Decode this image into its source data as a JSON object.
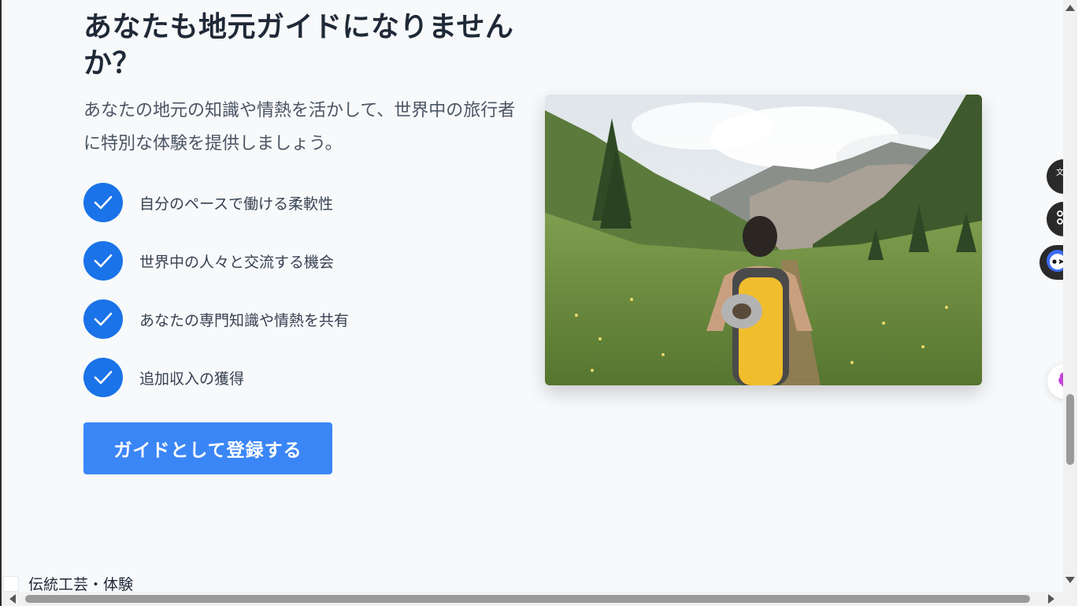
{
  "section": {
    "heading": "あなたも地元ガイドになりませんか？",
    "lead": "あなたの地元の知識や情熱を活かして、世界中の旅行者に特別な体験を提供しましょう。",
    "features": [
      {
        "label": "自分のペースで働ける柔軟性"
      },
      {
        "label": "世界中の人々と交流する機会"
      },
      {
        "label": "あなたの専門知識や情熱を共有"
      },
      {
        "label": "追加収入の獲得"
      }
    ],
    "cta_label": "ガイドとして登録する"
  },
  "footer": {
    "partial_item_label": "伝統工芸・体験"
  },
  "side_tools": {
    "translate_icon": "translate-icon",
    "apps_icon": "command-icon",
    "assistant_icon": "assistant-face-icon",
    "brain_icon": "brain-icon"
  },
  "colors": {
    "accent": "#1a73e8",
    "button": "#3b86f6",
    "heading": "#1f2937",
    "background": "#f7f9fb"
  }
}
